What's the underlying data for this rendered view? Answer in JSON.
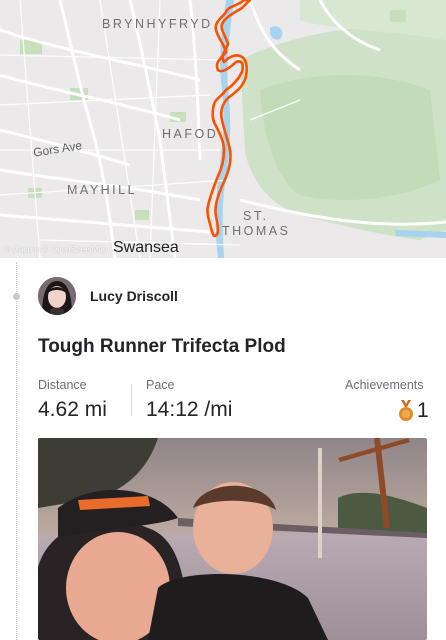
{
  "map": {
    "labels": {
      "brynhyfryd": "BRYNHYFRYD",
      "hafod": "HAFOD",
      "gors_ave": "Gors Ave",
      "mayhill": "MAYHILL",
      "st": "ST.",
      "thomas": "THOMAS",
      "swansea": "Swansea"
    },
    "attribution": "© Mapbox © OpenStreetMap",
    "route_color": "#fc5200"
  },
  "activity": {
    "athlete_name": "Lucy Driscoll",
    "title": "Tough Runner Trifecta Plod",
    "stats": {
      "distance_label": "Distance",
      "distance_value": "4.62 mi",
      "pace_label": "Pace",
      "pace_value": "14:12 /mi",
      "achievements_label": "Achievements",
      "achievements_value": "1"
    }
  },
  "icons": {
    "medal": "medal-icon",
    "avatar": "avatar"
  }
}
